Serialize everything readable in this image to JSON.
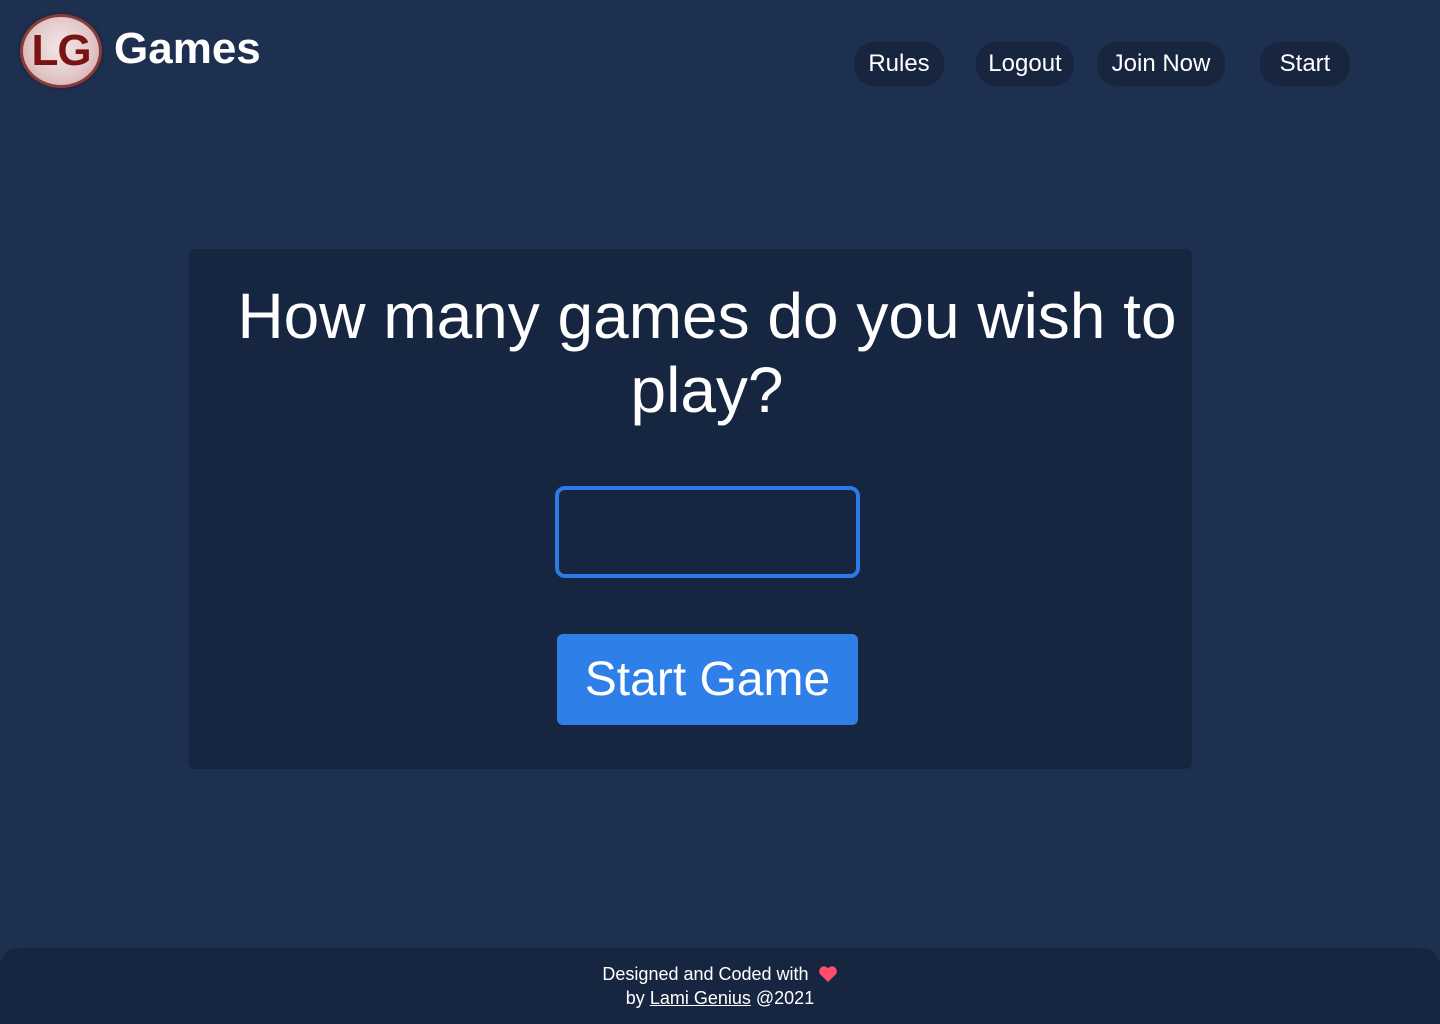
{
  "header": {
    "logo_text": "LG",
    "brand_name": "Games",
    "nav": {
      "rules": "Rules",
      "logout": "Logout",
      "join_now": "Join Now",
      "start": "Start"
    }
  },
  "main": {
    "question": "How many games do you wish to play?",
    "games_input_value": "",
    "start_button": "Start Game"
  },
  "footer": {
    "line1": "Designed and Coded with",
    "by": "by",
    "author": "Lami Genius",
    "year": "@2021",
    "heart_icon": "heart-icon"
  },
  "colors": {
    "background": "#1e3050",
    "card": "#172640",
    "accent": "#2f7fe9",
    "heart": "#ff4d6d"
  }
}
